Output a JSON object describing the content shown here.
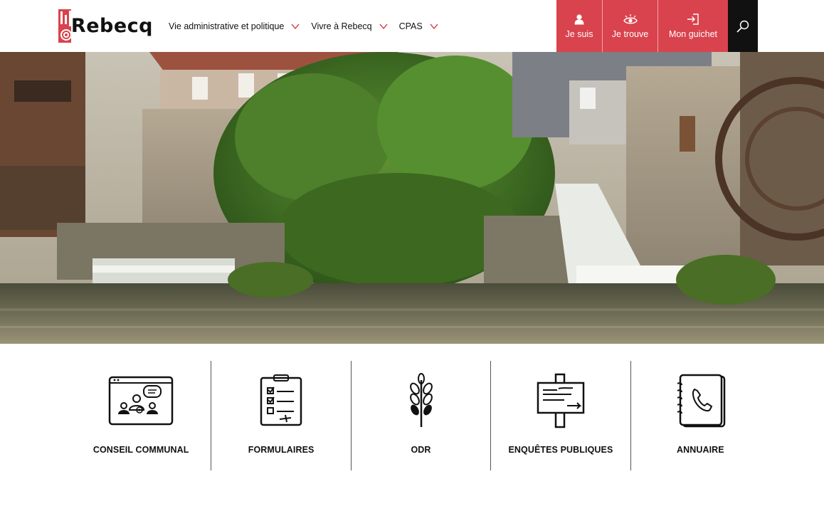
{
  "brand": {
    "name": "Rebecq",
    "accent": "#d9434d"
  },
  "nav": {
    "items": [
      {
        "label": "Vie administrative et politique"
      },
      {
        "label": "Vivre à Rebecq"
      },
      {
        "label": "CPAS"
      }
    ]
  },
  "quick_links": [
    {
      "label": "Je suis",
      "icon": "person-icon"
    },
    {
      "label": "Je trouve",
      "icon": "eye-icon"
    },
    {
      "label": "Mon guichet",
      "icon": "login-icon"
    }
  ],
  "search": {
    "icon": "search-icon"
  },
  "tiles": [
    {
      "label": "CONSEIL COMMUNAL",
      "icon": "video-meeting-icon"
    },
    {
      "label": "FORMULAIRES",
      "icon": "checklist-icon"
    },
    {
      "label": "ODR",
      "icon": "wheat-icon"
    },
    {
      "label": "ENQUÊTES PUBLIQUES",
      "icon": "signboard-icon"
    },
    {
      "label": "ANNUAIRE",
      "icon": "address-book-icon"
    }
  ]
}
